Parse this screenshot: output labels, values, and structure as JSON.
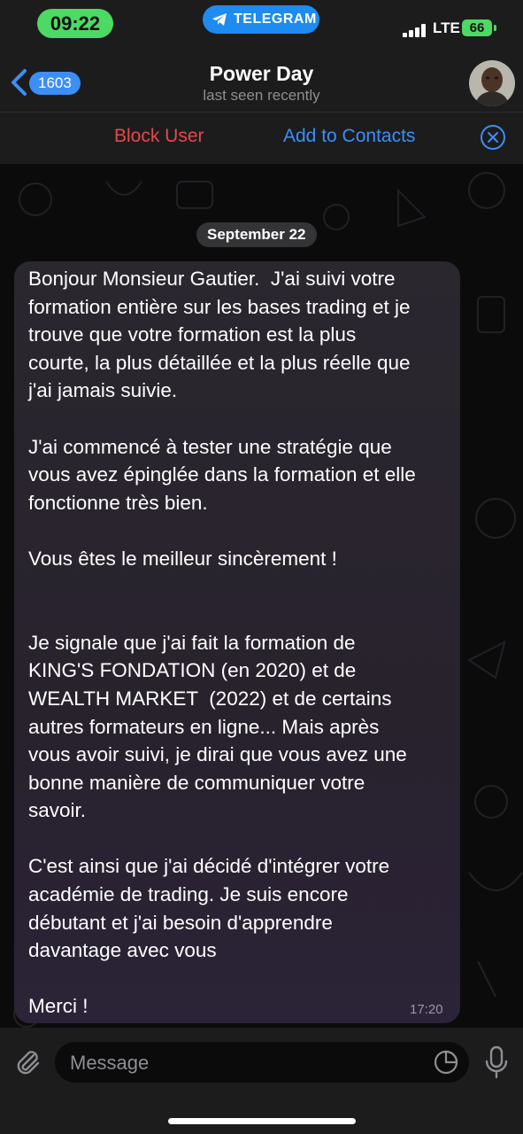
{
  "status_bar": {
    "time": "09:22",
    "app_pill": "TELEGRAM",
    "network": "LTE",
    "battery": "66"
  },
  "header": {
    "back_count": "1603",
    "title": "Power Day",
    "subtitle": "last seen recently"
  },
  "actions": {
    "block_label": "Block User",
    "add_label": "Add to Contacts"
  },
  "chat": {
    "date_label": "September 22",
    "message": {
      "text": "Bonjour Monsieur Gautier.  J'ai suivi votre\nformation entière sur les bases trading et je\ntrouve que votre formation est la plus\ncourte, la plus détaillée et la plus réelle que\nj'ai jamais suivie.\n\nJ'ai commencé à tester une stratégie que\nvous avez épinglée dans la formation et elle\nfonctionne très bien.\n\nVous êtes le meilleur sincèrement !\n\n\nJe signale que j'ai fait la formation de\nKING'S FONDATION (en 2020) et de\nWEALTH MARKET  (2022) et de certains\nautres formateurs en ligne... Mais après\nvous avoir suivi, je dirai que vous avez une\nbonne manière de communiquer votre\nsavoir.\n\nC'est ainsi que j'ai décidé d'intégrer votre\nacadémie de trading. Je suis encore\ndébutant et j'ai besoin d'apprendre\ndavantage avec vous\n\nMerci !",
      "time": "17:20"
    }
  },
  "composer": {
    "placeholder": "Message"
  },
  "colors": {
    "accent": "#3d8ef7",
    "danger": "#e5484d",
    "status_green": "#4cd964",
    "telegram_blue": "#1d8bf0"
  },
  "icons": [
    "telegram-plane-icon",
    "back-chevron-icon",
    "close-circle-icon",
    "avatar",
    "paperclip-icon",
    "sticker-icon",
    "microphone-icon"
  ]
}
